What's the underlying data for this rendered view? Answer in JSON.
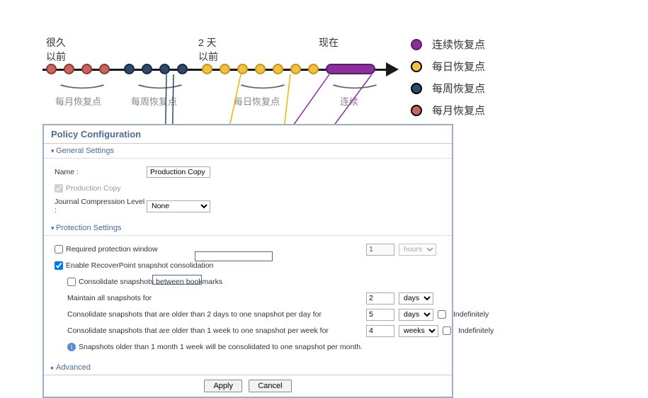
{
  "timeline": {
    "label_old": "很久\n以前",
    "label_2days": "2 天\n以前",
    "label_now": "现在",
    "braces": [
      "每月恢复点",
      "每周恢复点",
      "每日恢复点",
      "连续"
    ]
  },
  "legend": [
    {
      "color": "purple",
      "text": "连续恢复点"
    },
    {
      "color": "yellow",
      "text": "每日恢复点"
    },
    {
      "color": "blue",
      "text": "每周恢复点"
    },
    {
      "color": "red",
      "text": "每月恢复点"
    }
  ],
  "panel": {
    "title": "Policy Configuration",
    "section_general": "General Settings",
    "name_label": "Name :",
    "name_value": "Production Copy",
    "prod_copy": "Production Copy",
    "compression_label": "Journal Compression Level :",
    "compression_value": "None",
    "section_protection": "Protection Settings",
    "required_window": "Required protection window",
    "req_num": "1",
    "req_unit": "hours",
    "enable_consolidation": "Enable RecoverPoint snapshot consolidation",
    "between_bookmarks": "Consolidate snapshots between bookmarks",
    "maintain_label": "Maintain all snapshots for",
    "maintain_num": "2",
    "maintain_unit": "days",
    "older2_label_a": "Consolidate snapshots that are older than ",
    "older2_hl": "2 days to one snapshot",
    "older2_label_b": " per day for",
    "older2_num": "5",
    "older2_unit": "days",
    "indef": "Indefinitely",
    "older1w_label_a": "Consolidate snapshots that are older than ",
    "older1w_hl": "1 week to one snapshot",
    "older1w_label_b": " per week for",
    "older1w_num": "4",
    "older1w_unit": "weeks",
    "info_a": "Snapshots older than ",
    "info_hl": "1 month 1 week",
    "info_b": " will be consolidated to one snapshot per month.",
    "section_advanced": "Advanced",
    "apply": "Apply",
    "cancel": "Cancel"
  }
}
